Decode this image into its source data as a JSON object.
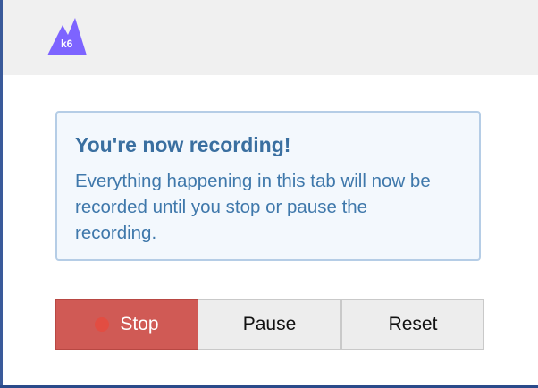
{
  "header": {
    "logo_text": "k6",
    "logo_icon": "k6-mountain-logo",
    "logo_color": "#7d64ff"
  },
  "alert": {
    "title": "You're now recording!",
    "body": "Everything happening in this tab will now be recorded until you stop or pause the recording.",
    "background_color": "#f3f8fd",
    "border_color": "#b5cde6",
    "text_color": "#3f78ab"
  },
  "controls": {
    "stop_label": "Stop",
    "pause_label": "Pause",
    "reset_label": "Reset",
    "stop_color": "#d05a55",
    "recording_dot_icon": "record-dot-icon",
    "recording_dot_color": "#e24d42"
  }
}
